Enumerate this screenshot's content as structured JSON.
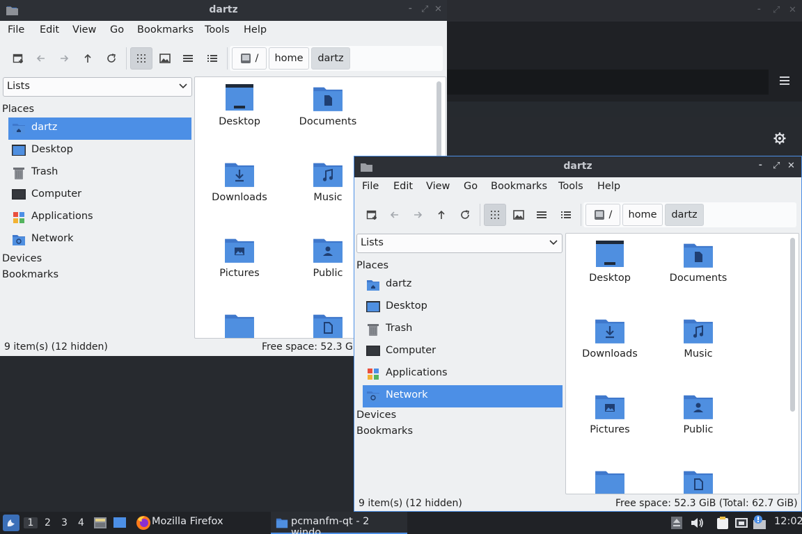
{
  "window_title": "dartz",
  "menu": [
    "File",
    "Edit",
    "View",
    "Go",
    "Bookmarks",
    "Tools",
    "Help"
  ],
  "path": {
    "root": "/",
    "segments": [
      "home",
      "dartz"
    ]
  },
  "side_pane_mode": "Lists",
  "sidebar": {
    "places_label": "Places",
    "places": [
      {
        "label": "dartz",
        "icon": "home-folder-icon"
      },
      {
        "label": "Desktop",
        "icon": "desktop-icon"
      },
      {
        "label": "Trash",
        "icon": "trash-icon"
      },
      {
        "label": "Computer",
        "icon": "computer-icon"
      },
      {
        "label": "Applications",
        "icon": "applications-icon"
      },
      {
        "label": "Network",
        "icon": "network-icon"
      }
    ],
    "devices_label": "Devices",
    "bookmarks_label": "Bookmarks"
  },
  "files": [
    {
      "name": "Desktop",
      "icon": "desktop-folder-icon"
    },
    {
      "name": "Documents",
      "icon": "documents-folder-icon"
    },
    {
      "name": "Downloads",
      "icon": "downloads-folder-icon"
    },
    {
      "name": "Music",
      "icon": "music-folder-icon"
    },
    {
      "name": "Pictures",
      "icon": "pictures-folder-icon"
    },
    {
      "name": "Public",
      "icon": "public-folder-icon"
    },
    {
      "name": "",
      "icon": "folder-icon"
    },
    {
      "name": "",
      "icon": "templates-folder-icon"
    }
  ],
  "status": {
    "items": "9 item(s) (12 hidden)",
    "free_short": "Free space: 52.3 GiB",
    "free_full": "Free space: 52.3 GiB (Total: 62.7 GiB)"
  },
  "taskbar": {
    "workspaces": [
      "1",
      "2",
      "3",
      "4"
    ],
    "active_workspace": "1",
    "tasks": [
      {
        "label": "Mozilla Firefox",
        "icon": "firefox-icon"
      },
      {
        "label": "pcmanfm-qt - 2 windo...",
        "icon": "folder-icon"
      }
    ],
    "clock": "12:02"
  },
  "colors": {
    "accent": "#4c8fe6",
    "folder": "#4a86d8",
    "titlebar": "#2d3036",
    "taskbar": "#202226"
  }
}
